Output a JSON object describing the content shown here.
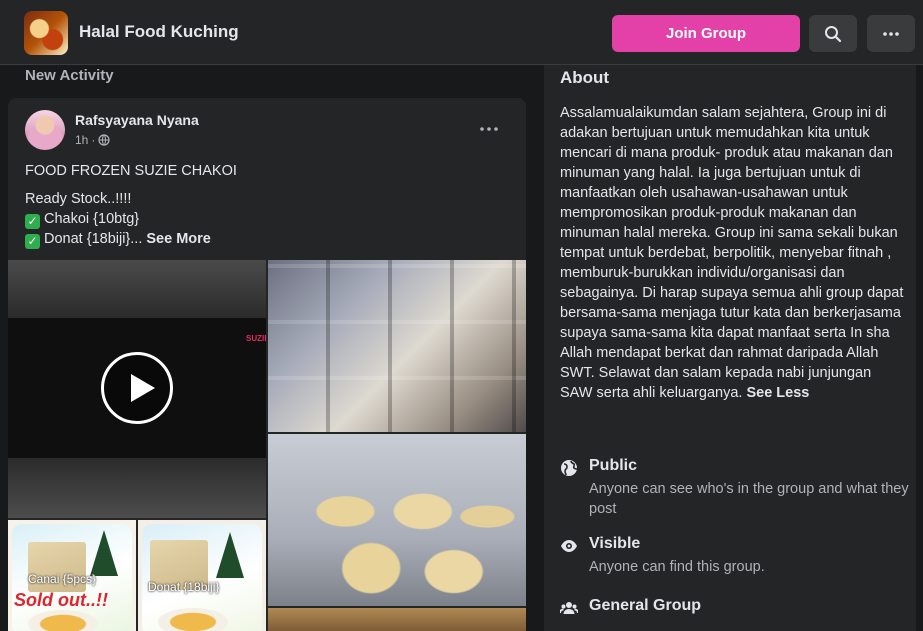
{
  "header": {
    "group_name": "Halal Food Kuching",
    "join_button": "Join Group",
    "search_icon": "search-icon",
    "more_icon": "more-horizontal-icon"
  },
  "feed": {
    "section_label": "New Activity",
    "post": {
      "author": "Rafsyayana Nyana",
      "time": "1h",
      "audience_icon": "globe-icon",
      "lines": [
        "FOOD FROZEN SUZIE CHAKOI",
        "Ready Stock..!!!!",
        "Chakoi {10btg}",
        "Donat {18biji}..."
      ],
      "see_more": "See More",
      "media": {
        "video_brand": "SUZIE",
        "photo_label_1": "Canai {5pcs}",
        "photo_label_2": "Donat {18biji}",
        "sold_out": "Sold out..!!"
      }
    }
  },
  "about": {
    "title": "About",
    "description": "Assalamualaikumdan salam sejahtera, Group ini di adakan bertujuan untuk memudahkan kita untuk mencari di mana produk- produk atau makanan dan minuman yang halal. Ia juga bertujuan untuk di manfaatkan oleh usahawan-usahawan untuk mempromosikan produk-produk makanan dan minuman halal mereka. Group ini sama sekali bukan tempat untuk berdebat, berpolitik, menyebar fitnah , memburuk-burukkan individu/organisasi dan sebagainya. Di harap supaya semua ahli group dapat bersama-sama menjaga tutur kata dan berkerjasama supaya sama-sama kita dapat manfaat serta In sha Allah mendapat berkat dan rahmat daripada Allah SWT. Selawat dan salam kepada nabi junjungan SAW serta ahli keluarganya.",
    "see_less": "See Less",
    "public": {
      "title": "Public",
      "desc": "Anyone can see who's in the group and what they post"
    },
    "visible": {
      "title": "Visible",
      "desc": "Anyone can find this group."
    },
    "general": {
      "title": "General Group"
    }
  }
}
